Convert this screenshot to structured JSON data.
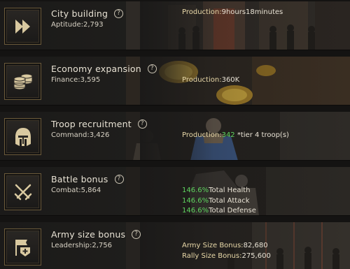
{
  "rows": [
    {
      "title": "City building",
      "stat_label": "Aptitude:",
      "stat_value": "2,793",
      "lines": [
        {
          "label": "Production:",
          "value": "9hours18minutes"
        }
      ]
    },
    {
      "title": "Economy expansion",
      "stat_label": "Finance:",
      "stat_value": "3,595",
      "lines": [
        {
          "label": "Production:",
          "value": "360K"
        }
      ]
    },
    {
      "title": "Troop recruitment",
      "stat_label": "Command:",
      "stat_value": "3,426",
      "lines": [
        {
          "label": "Production:",
          "value": "342",
          "suffix": " *tier 4 troop(s)"
        }
      ]
    },
    {
      "title": "Battle bonus",
      "stat_label": "Combat:",
      "stat_value": "5,864",
      "lines": [
        {
          "percent": "146.6%",
          "text": "Total Health"
        },
        {
          "percent": "146.6%",
          "text": "Total Attack"
        },
        {
          "percent": "146.6%",
          "text": "Total Defense"
        }
      ]
    },
    {
      "title": "Army size bonus",
      "stat_label": "Leadership:",
      "stat_value": "2,756",
      "lines": [
        {
          "label": "Army Size Bonus:",
          "value": "82,680"
        },
        {
          "label": "Rally Size Bonus:",
          "value": "275,600"
        }
      ]
    }
  ],
  "help_glyph": "?",
  "colors": {
    "accent_gold": "#e8d8a8",
    "bonus_green": "#5fd35f",
    "frame": "#6b5a3a"
  },
  "icons": [
    "fast-forward-icon",
    "coin-stack-icon",
    "helmet-icon",
    "crossed-swords-icon",
    "army-banner-icon"
  ]
}
